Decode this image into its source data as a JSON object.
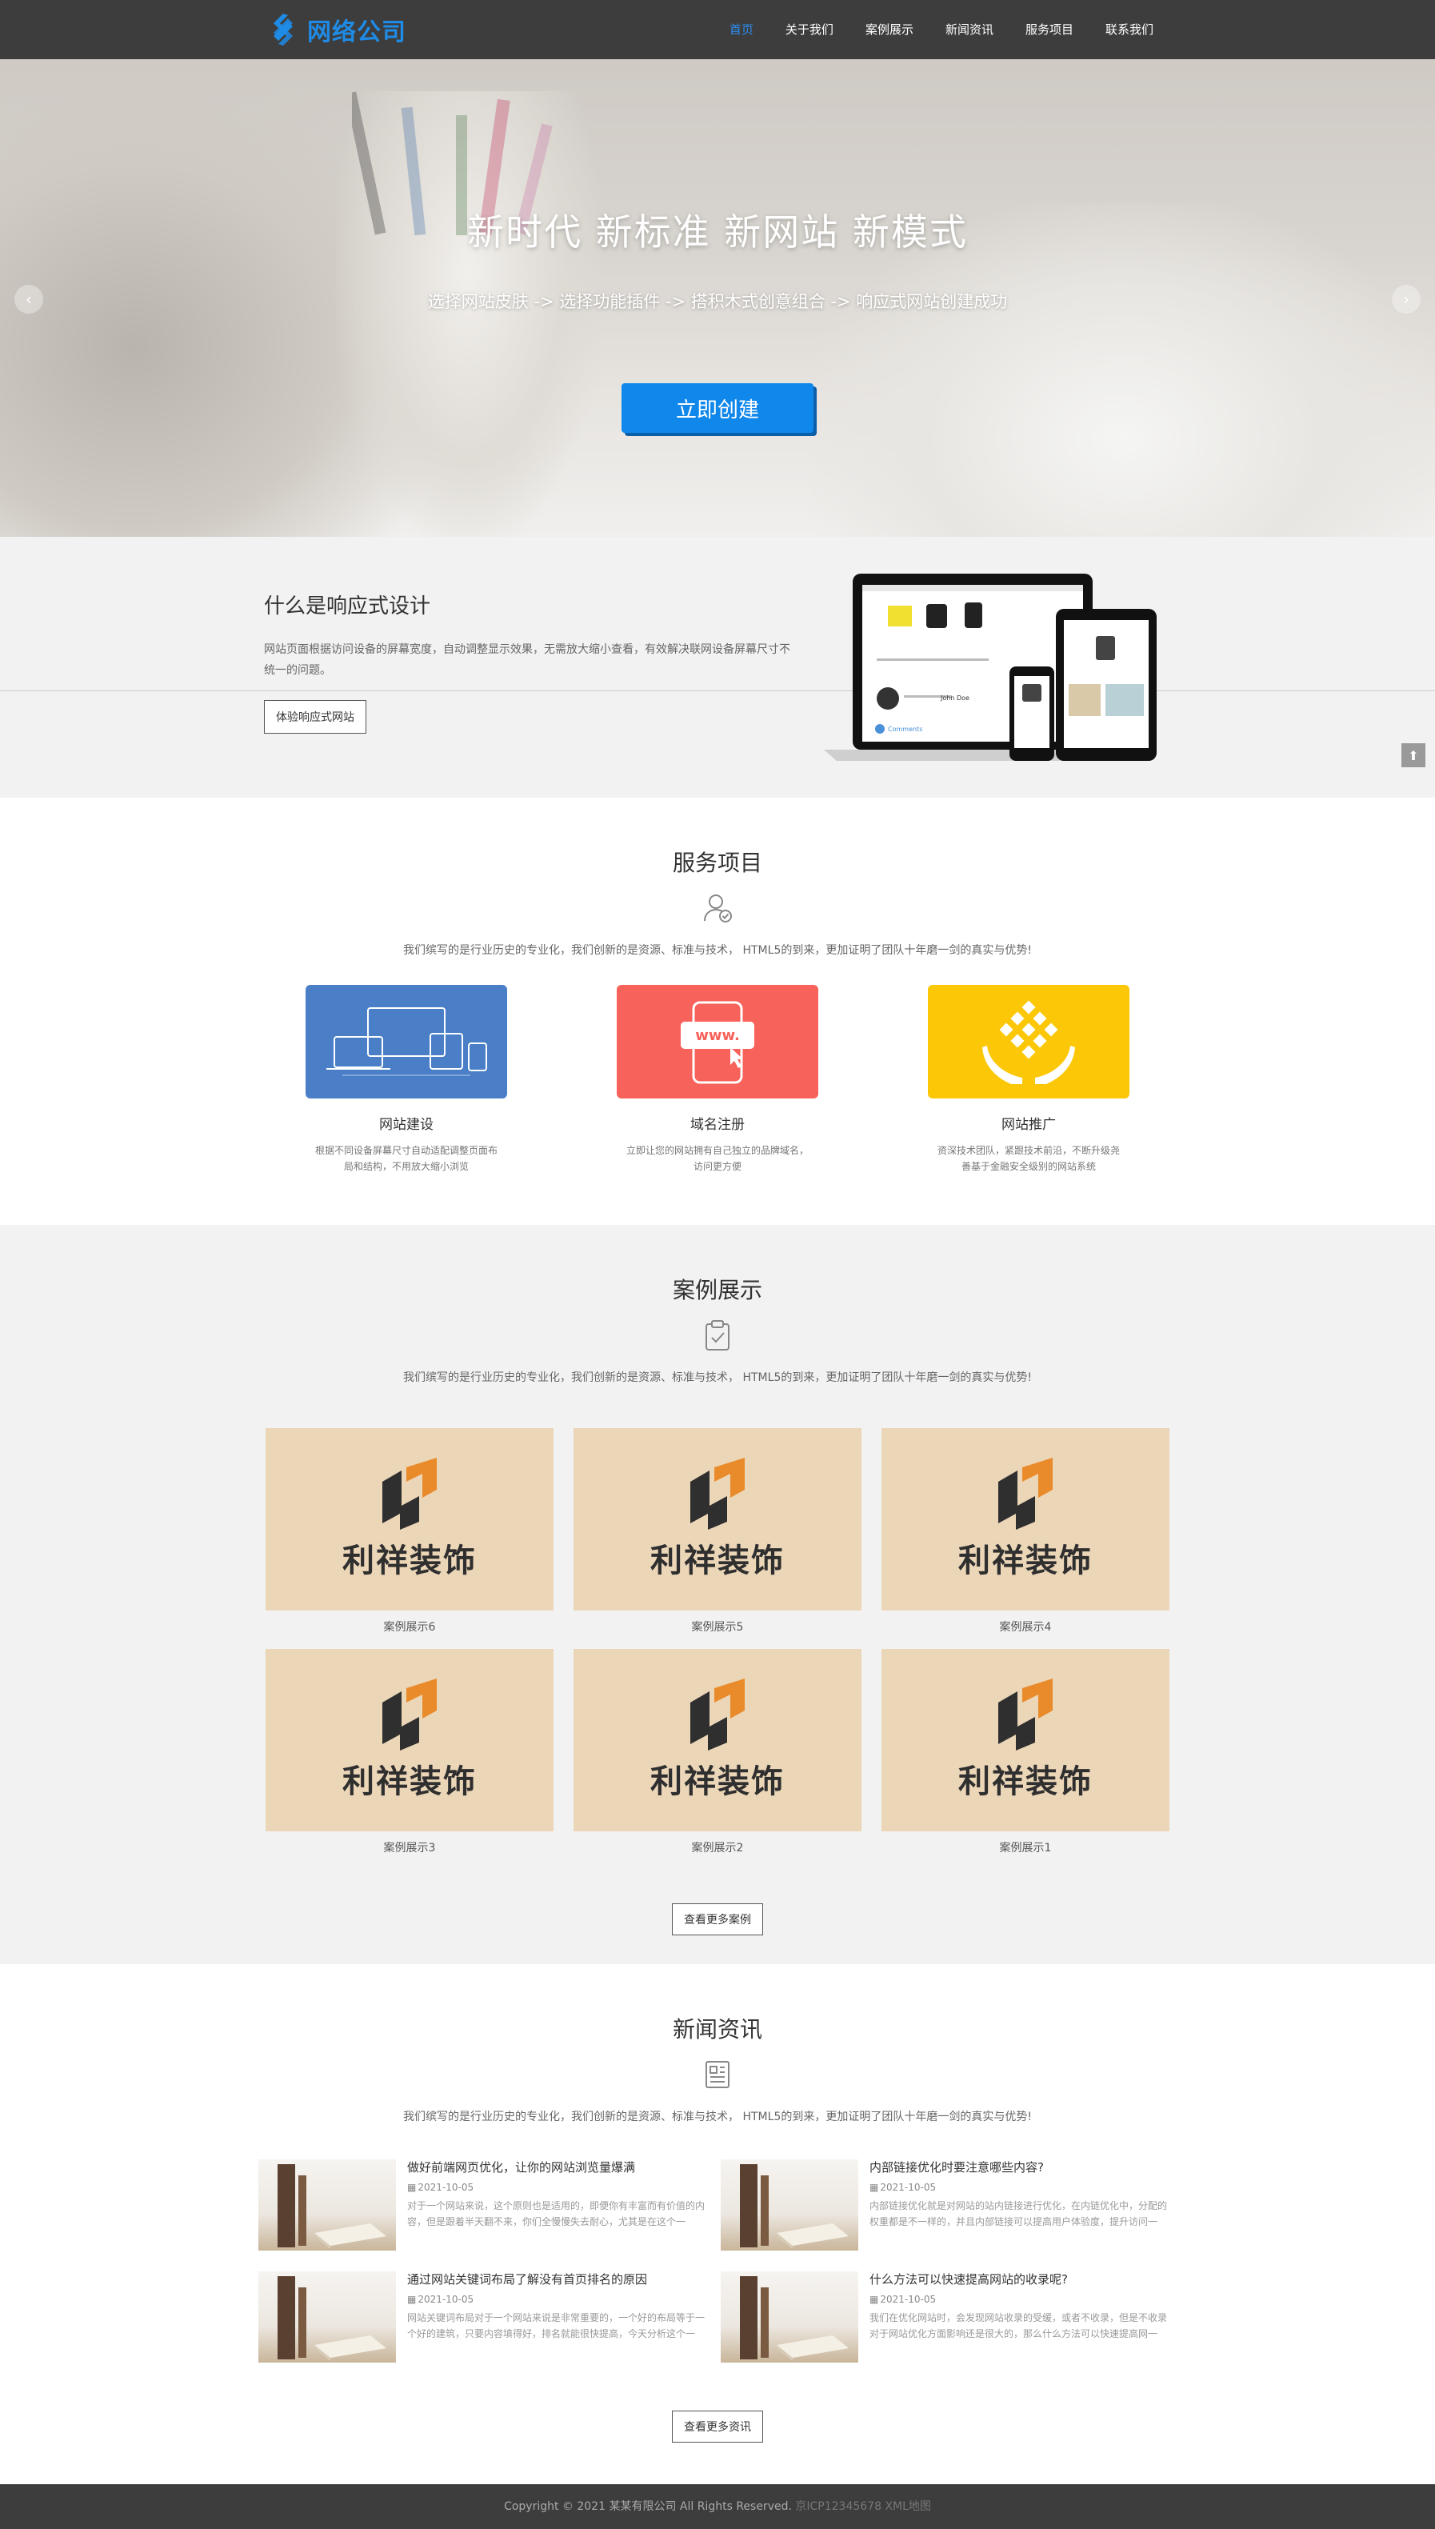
{
  "header": {
    "logo_text": "网络公司",
    "nav": [
      {
        "label": "首页",
        "active": true
      },
      {
        "label": "关于我们"
      },
      {
        "label": "案例展示"
      },
      {
        "label": "新闻资讯"
      },
      {
        "label": "服务项目"
      },
      {
        "label": "联系我们"
      }
    ]
  },
  "hero": {
    "title": "新时代  新标准  新网站  新模式",
    "subtitle": "选择网站皮肤 -> 选择功能插件 -> 搭积木式创意组合 -> 响应式网站创建成功",
    "cta": "立即创建"
  },
  "responsive": {
    "title": "什么是响应式设计",
    "desc": "网站页面根据访问设备的屏幕宽度，自动调整显示效果，无需放大缩小查看，有效解决联网设备屏幕尺寸不统一的问题。",
    "button": "体验响应式网站",
    "screen_author": "John Doe",
    "screen_comments": "Comments"
  },
  "services": {
    "title": "服务项目",
    "desc": "我们缤写的是行业历史的专业化，我们创新的是资源、标准与技术， HTML5的到来，更加证明了团队十年磨一剑的真实与优势!",
    "items": [
      {
        "name": "网站建设",
        "text": "根据不同设备屏幕尺寸自动适配调整页面布局和结构，不用放大缩小浏览",
        "color": "#4a7fc7"
      },
      {
        "name": "域名注册",
        "text": "立即让您的网站拥有自己独立的品牌域名，访问更方便",
        "color": "#f7625a",
        "badge": "www."
      },
      {
        "name": "网站推广",
        "text": "资深技术团队，紧跟技术前沿，不断升级尧善基于金融安全级别的网站系统",
        "color": "#fbc707"
      }
    ]
  },
  "cases": {
    "title": "案例展示",
    "desc": "我们缤写的是行业历史的专业化，我们创新的是资源、标准与技术， HTML5的到来，更加证明了团队十年磨一剑的真实与优势!",
    "brand": "利祥装饰",
    "items": [
      "案例展示6",
      "案例展示5",
      "案例展示4",
      "案例展示3",
      "案例展示2",
      "案例展示1"
    ],
    "more": "查看更多案例"
  },
  "news": {
    "title": "新闻资讯",
    "desc": "我们缤写的是行业历史的专业化，我们创新的是资源、标准与技术， HTML5的到来，更加证明了团队十年磨一剑的真实与优势!",
    "items": [
      {
        "title": "做好前端网页优化，让你的网站浏览量爆满",
        "date": "2021-10-05",
        "summary": "对于一个网站来说，这个原则也是适用的，即便你有丰富而有价值的内容，但是跟着半天翻不来，你们全慢慢失去耐心，尤其是在这个一"
      },
      {
        "title": "内部链接优化时要注意哪些内容?",
        "date": "2021-10-05",
        "summary": "内部链接优化就是对网站的站内链接进行优化，在内链优化中，分配的权重都是不一样的，并且内部链接可以提高用户体验度，提升访问一"
      },
      {
        "title": "通过网站关键词布局了解没有首页排名的原因",
        "date": "2021-10-05",
        "summary": "网站关键词布局对于一个网站来说是非常重要的，一个好的布局等于一个好的建筑，只要内容填得好，排名就能很快提高，今天分析这个一"
      },
      {
        "title": "什么方法可以快速提高网站的收录呢?",
        "date": "2021-10-05",
        "summary": "我们在优化网站时，会发现网站收录的受缓，或者不收录，但是不收录对于网站优化方面影响还是很大的，那么什么方法可以快速提高网一"
      }
    ],
    "more": "查看更多资讯"
  },
  "footer": {
    "copyright": "Copyright © 2021 某某有限公司 All Rights Reserved.",
    "icp": "京ICP12345678",
    "sitemap": "XML地图"
  },
  "colors": {
    "brand": "#1e8be6",
    "header_bg": "#3d3d3d",
    "cta": "#1087ea"
  }
}
